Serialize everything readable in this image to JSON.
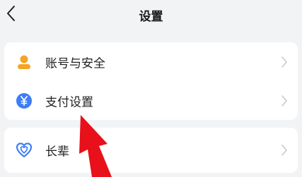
{
  "header": {
    "title": "设置"
  },
  "settings": {
    "group1": [
      {
        "label": "账号与安全",
        "icon": "person-icon"
      },
      {
        "label": "支付设置",
        "icon": "yuan-icon"
      }
    ],
    "group2": [
      {
        "label": "长辈",
        "icon": "heart-icon"
      }
    ]
  },
  "colors": {
    "background": "#f2f3f5",
    "card": "#ffffff",
    "person_icon": "#f5a524",
    "yuan_icon": "#3d7df5",
    "heart_icon": "#3d7df5",
    "annotation_arrow": "#e8101a"
  }
}
